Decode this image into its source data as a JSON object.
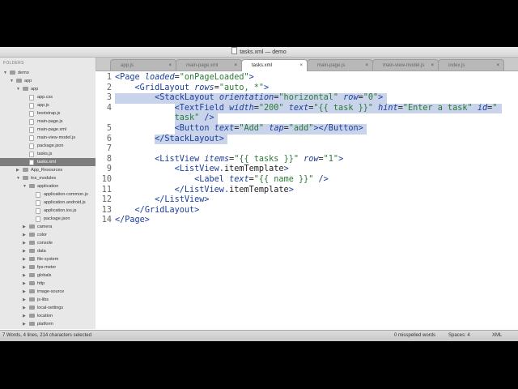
{
  "window": {
    "title": "tasks.xml — demo"
  },
  "tabs": [
    {
      "label": "app.js",
      "active": false
    },
    {
      "label": "main-page.xml",
      "active": false
    },
    {
      "label": "tasks.xml",
      "active": true
    },
    {
      "label": "main-page.js",
      "active": false
    },
    {
      "label": "main-view-model.js",
      "active": false
    },
    {
      "label": "index.js",
      "active": false
    }
  ],
  "sidebar": {
    "header": "FOLDERS",
    "items": [
      {
        "label": "demo",
        "type": "folder",
        "depth": 0,
        "open": true,
        "selected": false
      },
      {
        "label": "app",
        "type": "folder",
        "depth": 1,
        "open": true,
        "selected": false
      },
      {
        "label": "app",
        "type": "folder",
        "depth": 2,
        "open": true,
        "selected": false
      },
      {
        "label": "app.css",
        "type": "file",
        "depth": 3,
        "selected": false
      },
      {
        "label": "app.js",
        "type": "file",
        "depth": 3,
        "selected": false
      },
      {
        "label": "bootstrap.js",
        "type": "file",
        "depth": 3,
        "selected": false
      },
      {
        "label": "main-page.js",
        "type": "file",
        "depth": 3,
        "selected": false
      },
      {
        "label": "main-page.xml",
        "type": "file",
        "depth": 3,
        "selected": false
      },
      {
        "label": "main-view-model.js",
        "type": "file",
        "depth": 3,
        "selected": false
      },
      {
        "label": "package.json",
        "type": "file",
        "depth": 3,
        "selected": false
      },
      {
        "label": "tasks.js",
        "type": "file",
        "depth": 3,
        "selected": false
      },
      {
        "label": "tasks.xml",
        "type": "file",
        "depth": 3,
        "selected": true
      },
      {
        "label": "App_Resources",
        "type": "folder",
        "depth": 2,
        "open": false,
        "selected": false
      },
      {
        "label": "tns_modules",
        "type": "folder",
        "depth": 2,
        "open": true,
        "selected": false
      },
      {
        "label": "application",
        "type": "folder",
        "depth": 3,
        "open": true,
        "selected": false
      },
      {
        "label": "application-common.js",
        "type": "file",
        "depth": 4,
        "selected": false
      },
      {
        "label": "application.android.js",
        "type": "file",
        "depth": 4,
        "selected": false
      },
      {
        "label": "application.ios.js",
        "type": "file",
        "depth": 4,
        "selected": false
      },
      {
        "label": "package.json",
        "type": "file",
        "depth": 4,
        "selected": false
      },
      {
        "label": "camera",
        "type": "folder",
        "depth": 3,
        "open": false,
        "selected": false
      },
      {
        "label": "color",
        "type": "folder",
        "depth": 3,
        "open": false,
        "selected": false
      },
      {
        "label": "console",
        "type": "folder",
        "depth": 3,
        "open": false,
        "selected": false
      },
      {
        "label": "data",
        "type": "folder",
        "depth": 3,
        "open": false,
        "selected": false
      },
      {
        "label": "file-system",
        "type": "folder",
        "depth": 3,
        "open": false,
        "selected": false
      },
      {
        "label": "fps-meter",
        "type": "folder",
        "depth": 3,
        "open": false,
        "selected": false
      },
      {
        "label": "globals",
        "type": "folder",
        "depth": 3,
        "open": false,
        "selected": false
      },
      {
        "label": "http",
        "type": "folder",
        "depth": 3,
        "open": false,
        "selected": false
      },
      {
        "label": "image-source",
        "type": "folder",
        "depth": 3,
        "open": false,
        "selected": false
      },
      {
        "label": "js-libs",
        "type": "folder",
        "depth": 3,
        "open": false,
        "selected": false
      },
      {
        "label": "local-settings",
        "type": "folder",
        "depth": 3,
        "open": false,
        "selected": false
      },
      {
        "label": "location",
        "type": "folder",
        "depth": 3,
        "open": false,
        "selected": false
      },
      {
        "label": "platform",
        "type": "folder",
        "depth": 3,
        "open": false,
        "selected": false
      },
      {
        "label": "text",
        "type": "folder",
        "depth": 3,
        "open": false,
        "selected": false
      }
    ]
  },
  "editor": {
    "lines": [
      {
        "num": "1",
        "tokens": [
          [
            "t",
            "<Page "
          ],
          [
            "a",
            "loaded"
          ],
          [
            "p",
            "="
          ],
          [
            "s",
            "\"onPageLoaded\""
          ],
          [
            "t",
            ">"
          ]
        ]
      },
      {
        "num": "2",
        "tokens": [
          [
            "p",
            "    "
          ],
          [
            "t",
            "<GridLayout "
          ],
          [
            "a",
            "rows"
          ],
          [
            "p",
            "="
          ],
          [
            "s",
            "\"auto, *\""
          ],
          [
            "t",
            ">"
          ]
        ]
      },
      {
        "num": "3",
        "tokens": [
          [
            "p",
            "        "
          ],
          [
            "t",
            "<StackLayout "
          ],
          [
            "a",
            "orientation"
          ],
          [
            "p",
            "="
          ],
          [
            "s",
            "\"horizontal\""
          ],
          [
            "p",
            " "
          ],
          [
            "a",
            "row"
          ],
          [
            "p",
            "="
          ],
          [
            "s",
            "\"0\""
          ],
          [
            "t",
            ">"
          ]
        ]
      },
      {
        "num": "4",
        "tokens": [
          [
            "p",
            "            "
          ],
          [
            "t",
            "<TextField "
          ],
          [
            "a",
            "width"
          ],
          [
            "p",
            "="
          ],
          [
            "s",
            "\"200\""
          ],
          [
            "p",
            " "
          ],
          [
            "a",
            "text"
          ],
          [
            "p",
            "="
          ],
          [
            "s",
            "\"{{ task }}\""
          ],
          [
            "p",
            " "
          ],
          [
            "a",
            "hint"
          ],
          [
            "p",
            "="
          ],
          [
            "s",
            "\"Enter a task\""
          ],
          [
            "p",
            " "
          ],
          [
            "a",
            "id"
          ],
          [
            "p",
            "="
          ],
          [
            "s",
            "\""
          ]
        ]
      },
      {
        "num": "",
        "tokens": [
          [
            "p",
            "            "
          ],
          [
            "s",
            "task\""
          ],
          [
            "p",
            " "
          ],
          [
            "t",
            "/>"
          ]
        ]
      },
      {
        "num": "5",
        "tokens": [
          [
            "p",
            "            "
          ],
          [
            "t",
            "<Button "
          ],
          [
            "a",
            "text"
          ],
          [
            "p",
            "="
          ],
          [
            "s",
            "\"Add\""
          ],
          [
            "p",
            " "
          ],
          [
            "a",
            "tap"
          ],
          [
            "p",
            "="
          ],
          [
            "s",
            "\"add\""
          ],
          [
            "t",
            "></Button>"
          ]
        ]
      },
      {
        "num": "6",
        "tokens": [
          [
            "p",
            "        "
          ],
          [
            "t",
            "</StackLayout>"
          ]
        ]
      },
      {
        "num": "7",
        "tokens": []
      },
      {
        "num": "8",
        "tokens": [
          [
            "p",
            "        "
          ],
          [
            "t",
            "<ListView "
          ],
          [
            "a",
            "items"
          ],
          [
            "p",
            "="
          ],
          [
            "s",
            "\"{{ tasks }}\""
          ],
          [
            "p",
            " "
          ],
          [
            "a",
            "row"
          ],
          [
            "p",
            "="
          ],
          [
            "s",
            "\"1\""
          ],
          [
            "t",
            ">"
          ]
        ]
      },
      {
        "num": "9",
        "tokens": [
          [
            "p",
            "            "
          ],
          [
            "t",
            "<ListView."
          ],
          [
            "p",
            "itemTemplate"
          ],
          [
            "t",
            ">"
          ]
        ]
      },
      {
        "num": "10",
        "tokens": [
          [
            "p",
            "                "
          ],
          [
            "t",
            "<Label "
          ],
          [
            "a",
            "text"
          ],
          [
            "p",
            "="
          ],
          [
            "s",
            "\"{{ name }}\""
          ],
          [
            "p",
            " "
          ],
          [
            "t",
            "/>"
          ]
        ]
      },
      {
        "num": "11",
        "tokens": [
          [
            "p",
            "            "
          ],
          [
            "t",
            "</ListView."
          ],
          [
            "p",
            "itemTemplate"
          ],
          [
            "t",
            ">"
          ]
        ]
      },
      {
        "num": "12",
        "tokens": [
          [
            "p",
            "        "
          ],
          [
            "t",
            "</ListView>"
          ]
        ]
      },
      {
        "num": "13",
        "tokens": [
          [
            "p",
            "    "
          ],
          [
            "t",
            "</GridLayout>"
          ]
        ]
      },
      {
        "num": "14",
        "tokens": [
          [
            "t",
            "</Page>"
          ]
        ]
      }
    ],
    "selection_rows": [
      2,
      3,
      4,
      5,
      6
    ]
  },
  "statusbar": {
    "left": "7 Words, 4 lines, 214 characters selected",
    "spell": "0 misspelled words",
    "spaces": "Spaces: 4",
    "syntax": "XML"
  }
}
